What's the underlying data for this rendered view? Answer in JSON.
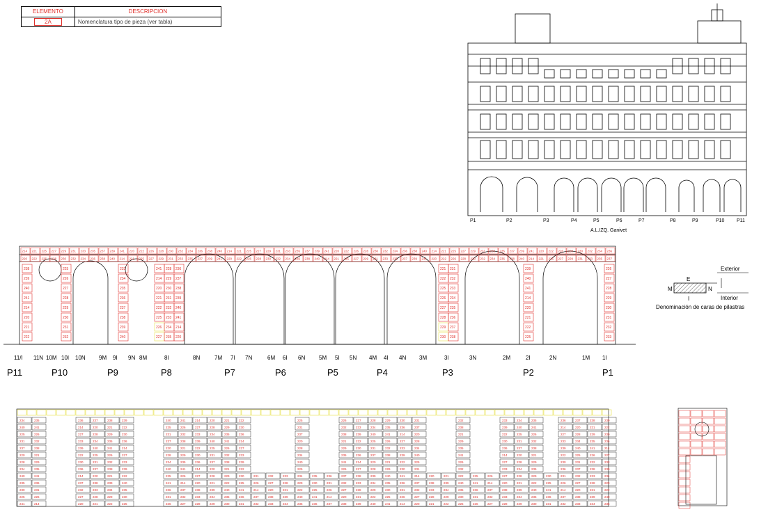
{
  "legend": {
    "col_element": "ELEMENTO",
    "col_description": "DESCRIPCION",
    "sample_code": "2A",
    "sample_description": "Nomenclatura tipo de pieza (ver tabla)"
  },
  "elevation": {
    "caption": "A.L.IZQ. Ganivet",
    "pier_labels": [
      "P1",
      "P2",
      "P3",
      "P4",
      "P5",
      "P6",
      "P7",
      "P8",
      "P9",
      "P10",
      "P11"
    ]
  },
  "face_legend": {
    "exterior": "Exterior",
    "interior": "Interior",
    "E": "E",
    "M": "M",
    "N": "N",
    "I": "I",
    "caption": "Denominación de caras de pilastras"
  },
  "face_labels": [
    "11/I",
    "11N",
    "10M",
    "10I",
    "10N",
    "9M",
    "9I",
    "9N",
    "8M",
    "8I",
    "8N",
    "7M",
    "7I",
    "7N",
    "6M",
    "6I",
    "6N",
    "5M",
    "5I",
    "5N",
    "4M",
    "4I",
    "4N",
    "3M",
    "3I",
    "3N",
    "2M",
    "2I",
    "2N",
    "1M",
    "1I"
  ],
  "pier_names": [
    "P11",
    "P10",
    "P9",
    "P8",
    "P7",
    "P6",
    "P5",
    "P4",
    "P3",
    "P2",
    "P1"
  ],
  "block_codes": [
    "214",
    "220",
    "221",
    "222",
    "225",
    "226",
    "227",
    "228",
    "229",
    "230",
    "231",
    "232",
    "233",
    "234",
    "235",
    "236",
    "237",
    "238",
    "239",
    "240",
    "241"
  ],
  "colors": {
    "red": "#e0302b",
    "yellow": "#e6e04a",
    "line": "#000000"
  }
}
